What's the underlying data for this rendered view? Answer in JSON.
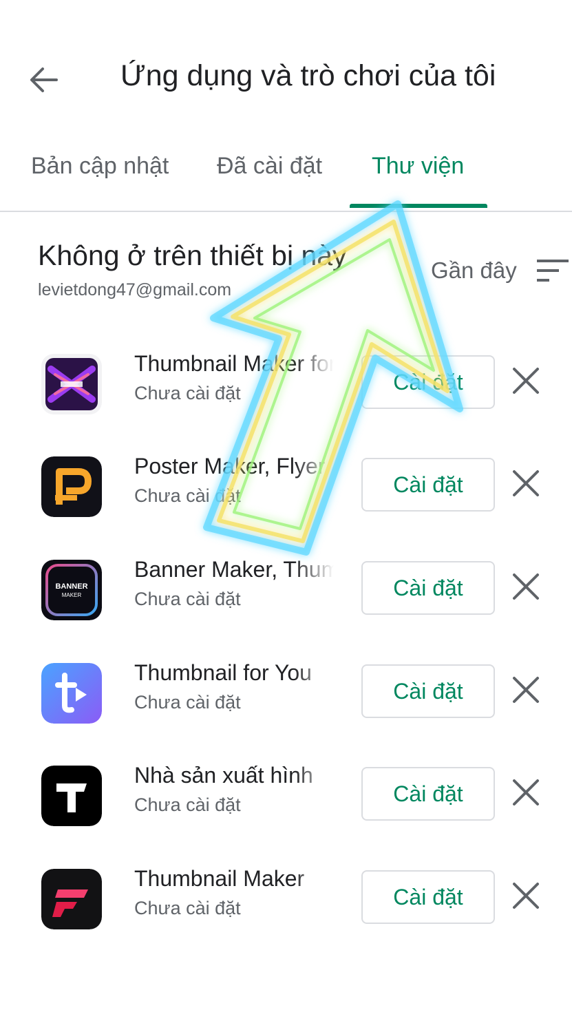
{
  "header": {
    "back_icon": "arrow-left-icon",
    "title": "Ứng dụng và trò chơi của tôi"
  },
  "tabs": [
    {
      "label": "Bản cập nhật",
      "active": false
    },
    {
      "label": "Đã cài đặt",
      "active": false
    },
    {
      "label": "Thư viện",
      "active": true
    }
  ],
  "library": {
    "section_title": "Không ở trên thiết bị này",
    "account": "levietdong47@gmail.com",
    "sort_label": "Gần đây",
    "sort_icon": "sort-icon"
  },
  "apps": [
    {
      "name": "Thumbnail Maker for",
      "status": "Chưa cài đặt",
      "button": "Cài đặt",
      "icon": "thumbnail-maker-icon"
    },
    {
      "name": "Poster Maker, Flyer",
      "status": "Chưa cài đặt",
      "button": "Cài đặt",
      "icon": "poster-maker-icon"
    },
    {
      "name": "Banner Maker, Thum",
      "status": "Chưa cài đặt",
      "button": "Cài đặt",
      "icon": "banner-maker-icon"
    },
    {
      "name": "Thumbnail for You",
      "status": "Chưa cài đặt",
      "button": "Cài đặt",
      "icon": "thumbnail-for-you-icon"
    },
    {
      "name": "Nhà sản xuất hình",
      "status": "Chưa cài đặt",
      "button": "Cài đặt",
      "icon": "thumbnail-t-icon"
    },
    {
      "name": "Thumbnail Maker",
      "status": "Chưa cài đặt",
      "button": "Cài đặt",
      "icon": "thumbnail-maker-f-icon"
    }
  ],
  "colors": {
    "accent": "#01875f",
    "text_primary": "#202124",
    "text_secondary": "#5f6368",
    "divider": "#dadce0"
  }
}
